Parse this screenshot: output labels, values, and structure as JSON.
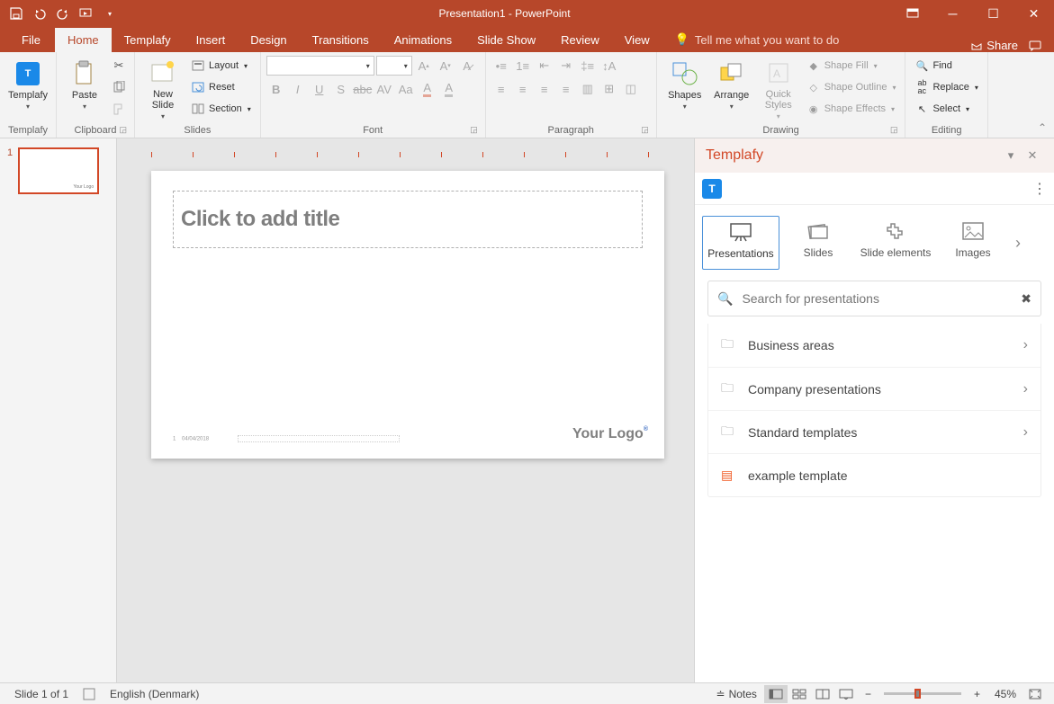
{
  "title": "Presentation1  -  PowerPoint",
  "qat_icons": [
    "save-icon",
    "undo-icon",
    "redo-icon",
    "start-from-beginning-icon",
    "customize-icon"
  ],
  "tabs": {
    "file": "File",
    "home": "Home",
    "templafy": "Templafy",
    "insert": "Insert",
    "design": "Design",
    "transitions": "Transitions",
    "animations": "Animations",
    "slideshow": "Slide Show",
    "review": "Review",
    "view": "View",
    "tellme": "Tell me what you want to do",
    "share": "Share"
  },
  "ribbon": {
    "templafy_group": {
      "label": "Templafy",
      "btn": "Templafy"
    },
    "clipboard": {
      "label": "Clipboard",
      "paste": "Paste"
    },
    "slides": {
      "label": "Slides",
      "newslide": "New\nSlide",
      "layout": "Layout",
      "reset": "Reset",
      "section": "Section"
    },
    "font": {
      "label": "Font",
      "name": "",
      "size": ""
    },
    "paragraph": {
      "label": "Paragraph"
    },
    "drawing": {
      "label": "Drawing",
      "shapes": "Shapes",
      "arrange": "Arrange",
      "quickstyles": "Quick\nStyles",
      "shapefill": "Shape Fill",
      "shapeoutline": "Shape Outline",
      "shapeeffects": "Shape Effects"
    },
    "editing": {
      "label": "Editing",
      "find": "Find",
      "replace": "Replace",
      "select": "Select"
    }
  },
  "thumb_number": "1",
  "slide": {
    "title_placeholder": "Click to add title",
    "logo_text": "Your Logo",
    "page_number": "1",
    "date": "04/04/2018"
  },
  "pane": {
    "title": "Templafy",
    "tabs": {
      "presentations": "Presentations",
      "slides": "Slides",
      "elements": "Slide elements",
      "images": "Images"
    },
    "search_placeholder": "Search for presentations",
    "folders": [
      {
        "type": "folder",
        "label": "Business areas"
      },
      {
        "type": "folder",
        "label": "Company presentations"
      },
      {
        "type": "folder",
        "label": "Standard templates"
      },
      {
        "type": "template",
        "label": "example template"
      }
    ]
  },
  "status": {
    "slide_counter": "Slide 1 of 1",
    "language": "English (Denmark)",
    "notes": "Notes",
    "zoom": "45%"
  }
}
